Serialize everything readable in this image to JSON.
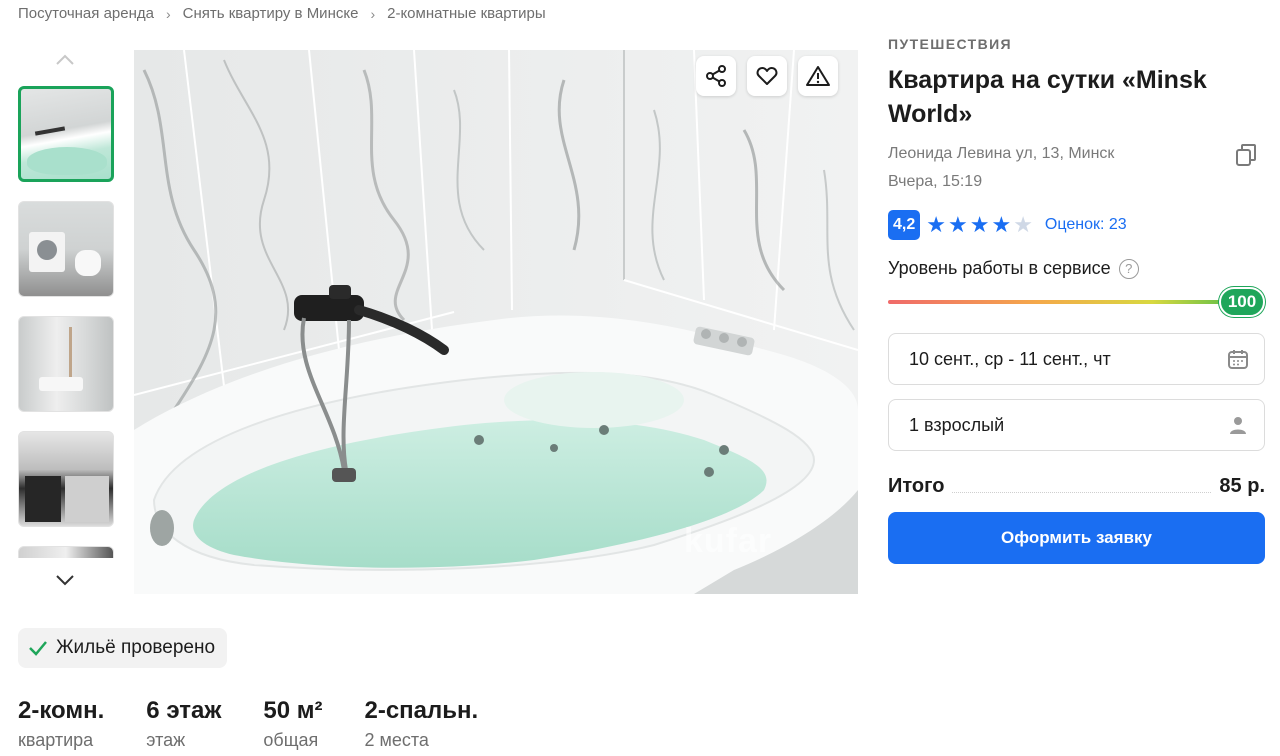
{
  "breadcrumb": {
    "items": [
      "Посуточная аренда",
      "Снять квартиру в Минске",
      "2-комнатные квартиры"
    ],
    "separator": "›"
  },
  "gallery": {
    "watermark": "kufar",
    "icons": [
      "share-icon",
      "heart-icon",
      "warning-icon"
    ]
  },
  "listing": {
    "category": "ПУТЕШЕСТВИЯ",
    "title": "Квартира на сутки «Minsk World»",
    "address": "Леонида Левина ул, 13, Минск",
    "date": "Вчера, 15:19"
  },
  "rating": {
    "score": "4,2",
    "stars_filled": 4,
    "reviews_label": "Оценок: 23"
  },
  "service": {
    "label": "Уровень работы в сервисе",
    "help": "?",
    "value": "100",
    "level_percent": 100
  },
  "booking": {
    "dates": "10 сент., ср - 11 сент., чт",
    "guests": "1 взрослый",
    "total_label": "Итого",
    "total_price": "85 р.",
    "submit_label": "Оформить заявку"
  },
  "verified": {
    "label": "Жильё проверено"
  },
  "specs": [
    {
      "main": "2-комн.",
      "sub": "квартира"
    },
    {
      "main": "6 этаж",
      "sub": "этаж"
    },
    {
      "main": "50 м²",
      "sub": "общая"
    },
    {
      "main": "2-спальн.",
      "sub": "2 места"
    }
  ],
  "colors": {
    "accent": "#1a6ef2",
    "success": "#1fa65a",
    "star": "#1a6ef2",
    "star_empty": "#cfd8e6"
  }
}
